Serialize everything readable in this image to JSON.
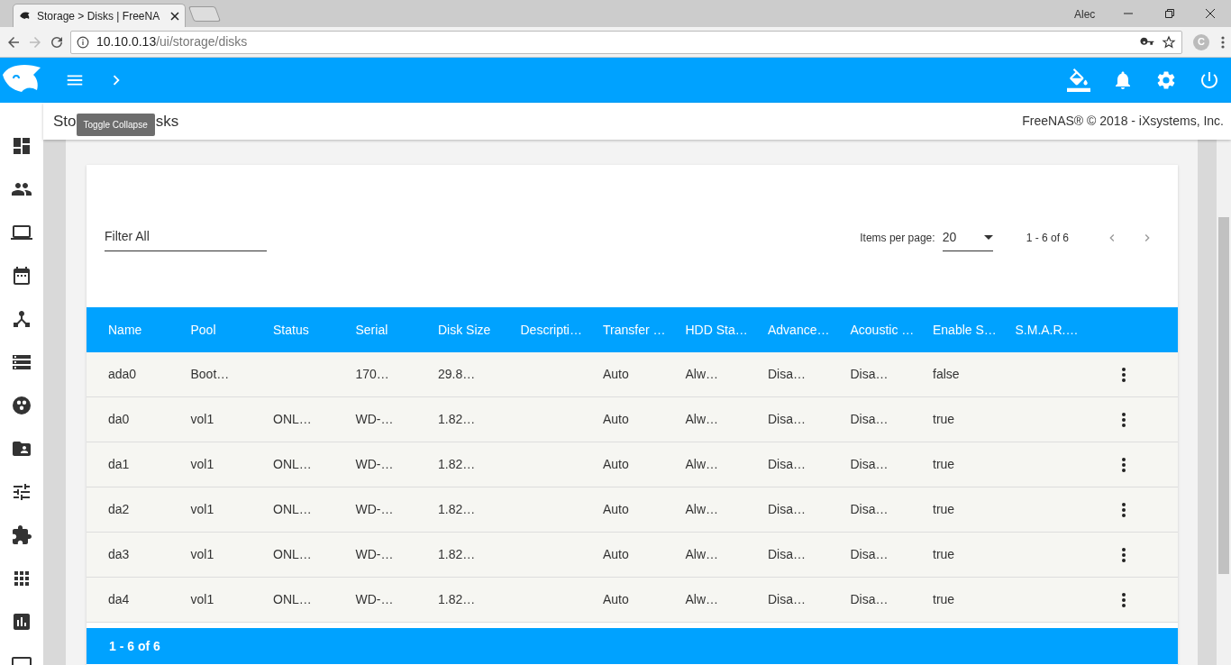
{
  "browser": {
    "tab_title": "Storage > Disks | FreeNA",
    "profile": "Alec",
    "url_host": "10.10.0.13",
    "url_path": "/ui/storage/disks",
    "extension_label": "C"
  },
  "tooltip": "Toggle Collapse",
  "page": {
    "breadcrumb_start": "Sto",
    "breadcrumb_end": "sks",
    "copyright": "FreeNAS® © 2018 - iXsystems, Inc."
  },
  "table": {
    "filter_placeholder": "Filter All",
    "items_per_page_label": "Items per page:",
    "items_per_page": "20",
    "range": "1 - 6 of 6",
    "columns": [
      "Name",
      "Pool",
      "Status",
      "Serial",
      "Disk Size",
      "Descripti…",
      "Transfer …",
      "HDD Sta…",
      "Advance…",
      "Acoustic …",
      "Enable S…",
      "S.M.A.R.…"
    ],
    "rows": [
      [
        "ada0",
        "Boot…",
        null,
        "170…",
        "29.8…",
        null,
        "Auto",
        "Alw…",
        "Disa…",
        "Disa…",
        "false",
        null
      ],
      [
        "da0",
        "vol1",
        "ONL…",
        "WD-…",
        "1.82…",
        null,
        "Auto",
        "Alw…",
        "Disa…",
        "Disa…",
        "true",
        null
      ],
      [
        "da1",
        "vol1",
        "ONL…",
        "WD-…",
        "1.82…",
        null,
        "Auto",
        "Alw…",
        "Disa…",
        "Disa…",
        "true",
        null
      ],
      [
        "da2",
        "vol1",
        "ONL…",
        "WD-…",
        "1.82…",
        null,
        "Auto",
        "Alw…",
        "Disa…",
        "Disa…",
        "true",
        null
      ],
      [
        "da3",
        "vol1",
        "ONL…",
        "WD-…",
        "1.82…",
        null,
        "Auto",
        "Alw…",
        "Disa…",
        "Disa…",
        "true",
        null
      ],
      [
        "da4",
        "vol1",
        "ONL…",
        "WD-…",
        "1.82…",
        null,
        "Auto",
        "Alw…",
        "Disa…",
        "Disa…",
        "true",
        null
      ]
    ],
    "footer": "1 - 6 of 6"
  }
}
